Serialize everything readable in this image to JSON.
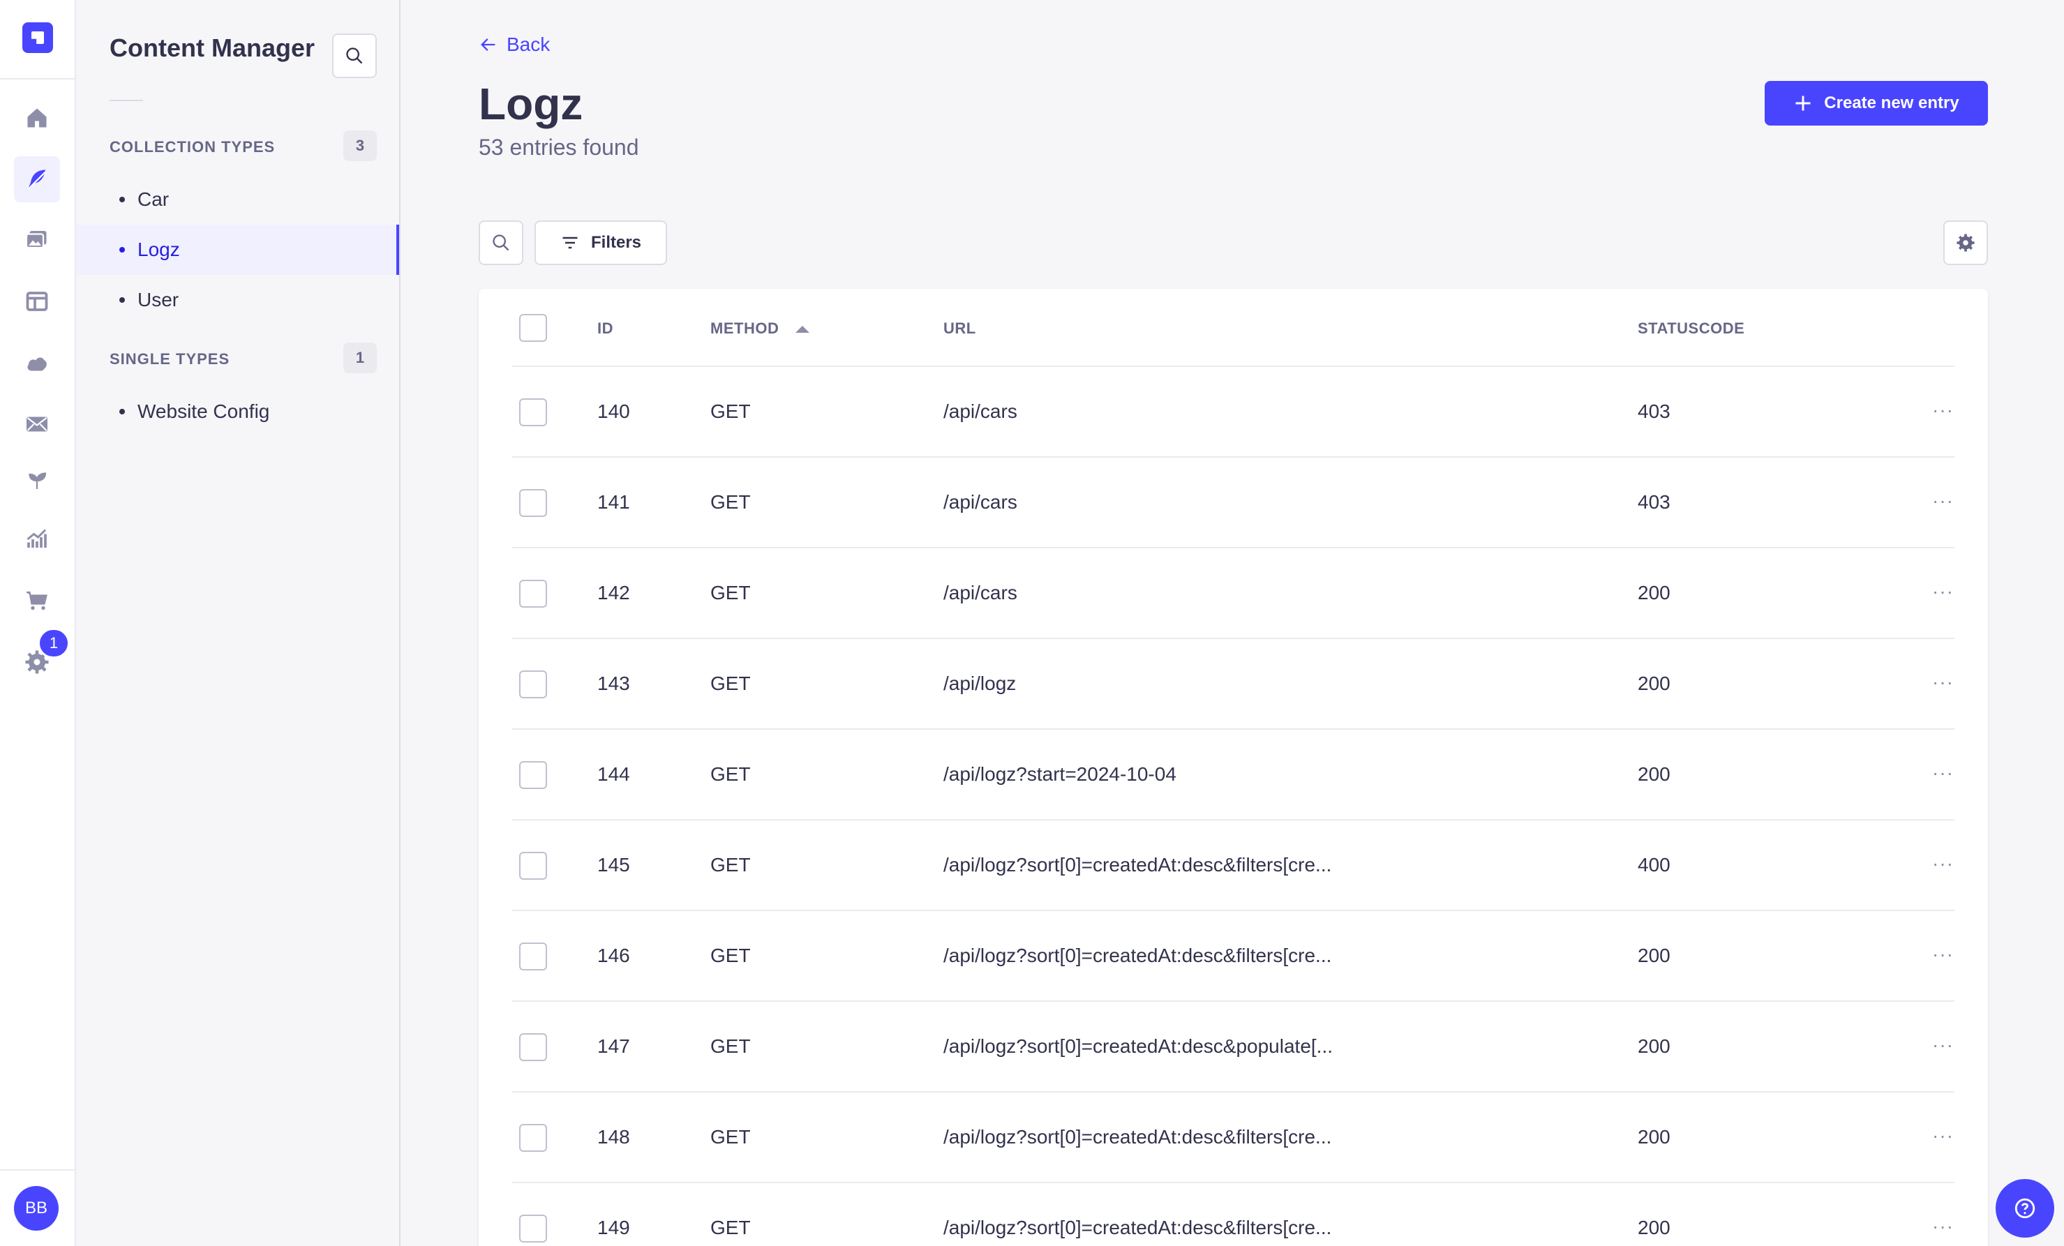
{
  "rail": {
    "badge": "1",
    "avatar": "BB",
    "icons": [
      "home-icon",
      "content-manager-icon",
      "media-library-icon",
      "layout-icon",
      "cloud-icon",
      "email-icon",
      "plugin-icon",
      "analytics-icon",
      "cart-icon",
      "settings-icon"
    ]
  },
  "sidebar": {
    "title": "Content Manager",
    "collection_label": "COLLECTION TYPES",
    "collection_count": "3",
    "collection_items": [
      "Car",
      "Logz",
      "User"
    ],
    "single_label": "SINGLE TYPES",
    "single_count": "1",
    "single_items": [
      "Website Config"
    ]
  },
  "header": {
    "back": "Back",
    "title": "Logz",
    "subtitle": "53 entries found",
    "create": "Create new entry"
  },
  "toolbar": {
    "filters": "Filters"
  },
  "table": {
    "columns": [
      "ID",
      "METHOD",
      "URL",
      "STATUSCODE"
    ],
    "more": "···",
    "rows": [
      {
        "id": "140",
        "method": "GET",
        "url": "/api/cars",
        "status": "403"
      },
      {
        "id": "141",
        "method": "GET",
        "url": "/api/cars",
        "status": "403"
      },
      {
        "id": "142",
        "method": "GET",
        "url": "/api/cars",
        "status": "200"
      },
      {
        "id": "143",
        "method": "GET",
        "url": "/api/logz",
        "status": "200"
      },
      {
        "id": "144",
        "method": "GET",
        "url": "/api/logz?start=2024-10-04",
        "status": "200"
      },
      {
        "id": "145",
        "method": "GET",
        "url": "/api/logz?sort[0]=createdAt:desc&filters[cre...",
        "status": "400"
      },
      {
        "id": "146",
        "method": "GET",
        "url": "/api/logz?sort[0]=createdAt:desc&filters[cre...",
        "status": "200"
      },
      {
        "id": "147",
        "method": "GET",
        "url": "/api/logz?sort[0]=createdAt:desc&populate[...",
        "status": "200"
      },
      {
        "id": "148",
        "method": "GET",
        "url": "/api/logz?sort[0]=createdAt:desc&filters[cre...",
        "status": "200"
      },
      {
        "id": "149",
        "method": "GET",
        "url": "/api/logz?sort[0]=createdAt:desc&filters[cre...",
        "status": "200"
      }
    ]
  },
  "colors": {
    "primary": "#4945ff",
    "text": "#32324d",
    "muted": "#666687"
  }
}
